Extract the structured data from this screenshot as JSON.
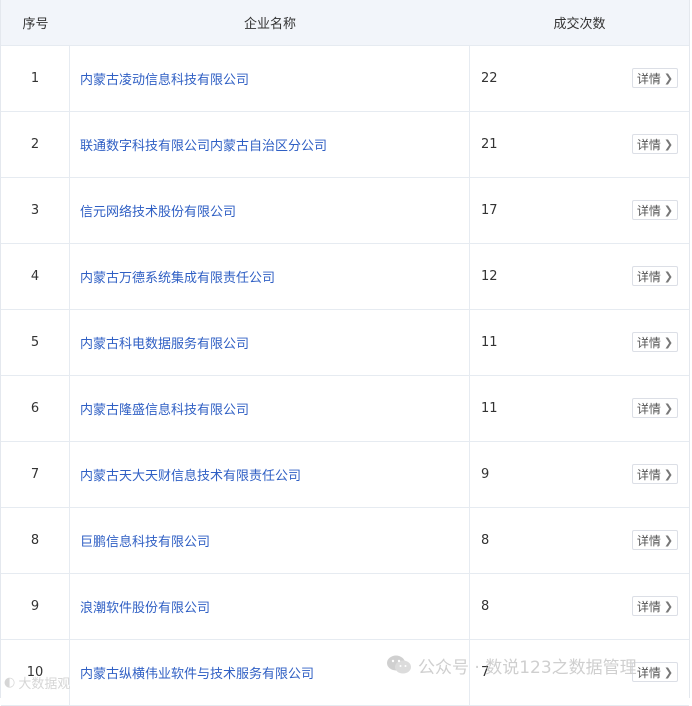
{
  "table": {
    "headers": {
      "index": "序号",
      "company": "企业名称",
      "count": "成交次数"
    },
    "detail_label": "详情",
    "rows": [
      {
        "index": "1",
        "company": "内蒙古凌动信息科技有限公司",
        "count": "22"
      },
      {
        "index": "2",
        "company": "联通数字科技有限公司内蒙古自治区分公司",
        "count": "21"
      },
      {
        "index": "3",
        "company": "信元网络技术股份有限公司",
        "count": "17"
      },
      {
        "index": "4",
        "company": "内蒙古万德系统集成有限责任公司",
        "count": "12"
      },
      {
        "index": "5",
        "company": "内蒙古科电数据服务有限公司",
        "count": "11"
      },
      {
        "index": "6",
        "company": "内蒙古隆盛信息科技有限公司",
        "count": "11"
      },
      {
        "index": "7",
        "company": "内蒙古天大天财信息技术有限责任公司",
        "count": "9"
      },
      {
        "index": "8",
        "company": "巨鹏信息科技有限公司",
        "count": "8"
      },
      {
        "index": "9",
        "company": "浪潮软件股份有限公司",
        "count": "8"
      },
      {
        "index": "10",
        "company": "内蒙古纵横伟业软件与技术服务有限公司",
        "count": "7"
      }
    ]
  },
  "watermark": {
    "text": "公众号 · 数说123之数据管理",
    "corner_text": "大数据观"
  }
}
